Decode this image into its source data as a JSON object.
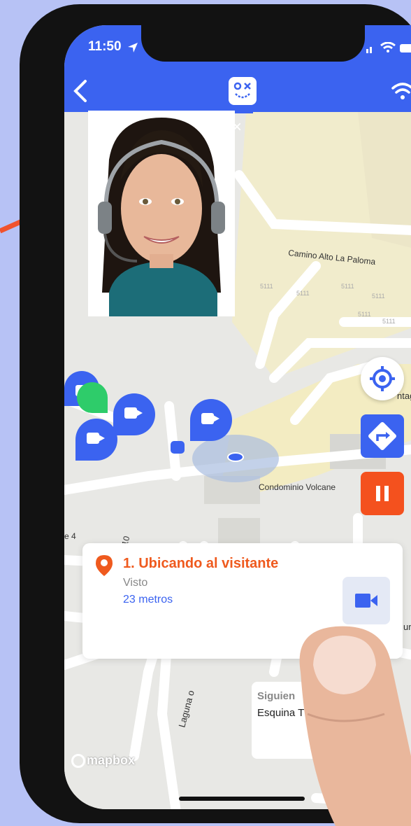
{
  "status": {
    "time": "11:50"
  },
  "header": {
    "logo_text": "°x\n◡"
  },
  "map": {
    "labels": [
      "Camino Alto La Paloma",
      "Condominio Volcane",
      "e 4",
      "10",
      "Laguna o",
      "ur",
      "ntag"
    ],
    "numbers": [
      "5111",
      "5111",
      "5111",
      "5111",
      "5111",
      "5111"
    ]
  },
  "card": {
    "title": "1. Ubicando al visitante",
    "status": "Visto",
    "distance": "23 metros"
  },
  "next": {
    "label": "Siguien",
    "street": "Esquina T"
  },
  "attribution": {
    "text": "mapbox"
  },
  "colors": {
    "accent": "#3b63f0",
    "orange": "#ef5a1e",
    "pause": "#f4511e"
  }
}
